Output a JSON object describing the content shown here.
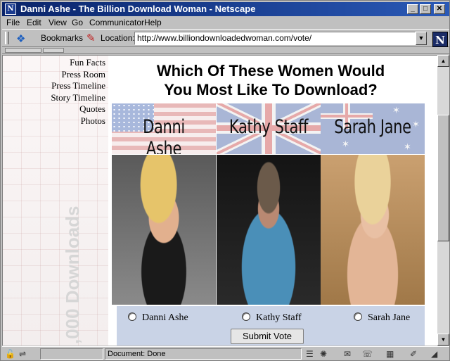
{
  "window": {
    "title": "Danni Ashe - The Billion Download Woman - Netscape",
    "min_glyph": "_",
    "max_glyph": "□",
    "close_glyph": "✕"
  },
  "menu": {
    "items": [
      "File",
      "Edit",
      "View",
      "Go",
      "Communicator",
      "Help"
    ]
  },
  "toolbar": {
    "bookmarks_label": "Bookmarks",
    "location_label": "Location:",
    "url": "http://www.billiondownloadedwoman.com/vote/",
    "dropdown_glyph": "▼",
    "logo": "N"
  },
  "page": {
    "nav": [
      "Fun Facts",
      "Press Room",
      "Press Timeline",
      "Story Timeline",
      "Quotes",
      "Photos"
    ],
    "watermark": ",000 Downloads",
    "headline_line1": "Which Of These Women Would",
    "headline_line2": "You Most Like To Download?",
    "candidates": [
      {
        "name": "Danni Ashe",
        "flag": "US",
        "option": "Danni Ashe"
      },
      {
        "name": "Kathy Staff",
        "flag": "UK",
        "option": "Kathy Staff"
      },
      {
        "name": "Sarah Jane",
        "flag": "Australia",
        "option": "Sarah Jane"
      }
    ],
    "submit_label": "Submit Vote",
    "vote_box_color": "#c9d3e6"
  },
  "scrollbar": {
    "up_glyph": "▲",
    "down_glyph": "▼"
  },
  "status": {
    "text": "Document: Done"
  },
  "colors": {
    "titlebar": "#0a246a",
    "chrome": "#c0c0c0"
  }
}
